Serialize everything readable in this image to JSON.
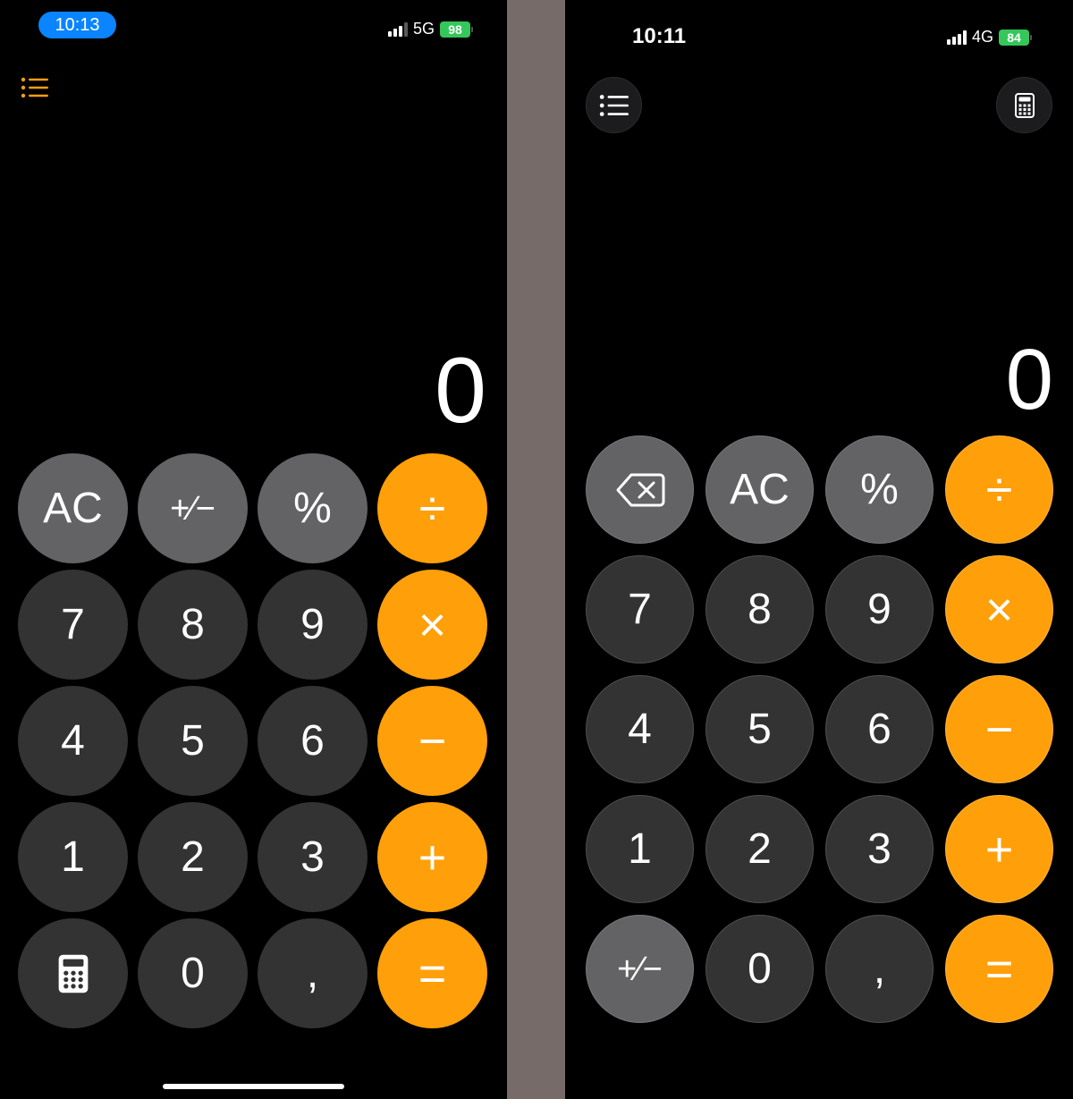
{
  "colors": {
    "orange": "#ff9f0a",
    "function_gray": "#636366",
    "number_dark": "#333333",
    "background": "#000000",
    "divider": "#776b69",
    "status_time_pill": "#0a84ff",
    "battery_green": "#34c759"
  },
  "left": {
    "status": {
      "time": "10:13",
      "network": "5G",
      "battery": "98"
    },
    "menu_icon": "list-icon",
    "display": "0",
    "keys": [
      [
        "AC",
        "+⁄−",
        "%",
        "÷"
      ],
      [
        "7",
        "8",
        "9",
        "×"
      ],
      [
        "4",
        "5",
        "6",
        "−"
      ],
      [
        "1",
        "2",
        "3",
        "+"
      ],
      [
        "calculator-icon",
        "0",
        ",",
        "="
      ]
    ]
  },
  "right": {
    "status": {
      "time": "10:11",
      "network": "4G",
      "battery": "84"
    },
    "menu_icon": "list-icon",
    "calc_icon": "calculator-icon",
    "display": "0",
    "keys": [
      [
        "backspace-icon",
        "AC",
        "%",
        "÷"
      ],
      [
        "7",
        "8",
        "9",
        "×"
      ],
      [
        "4",
        "5",
        "6",
        "−"
      ],
      [
        "1",
        "2",
        "3",
        "+"
      ],
      [
        "+⁄−",
        "0",
        ",",
        "="
      ]
    ]
  }
}
